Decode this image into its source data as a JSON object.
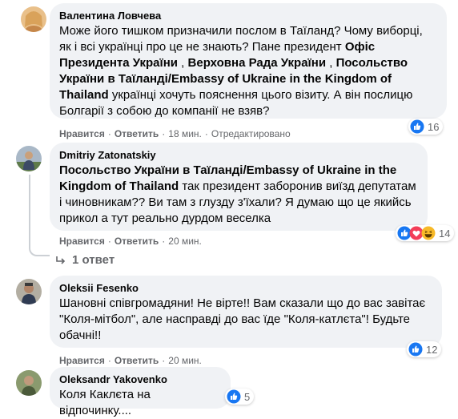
{
  "comments": [
    {
      "author": "Валентина Ловчева",
      "text_a": "Може його тишком призначили послом в Таїланд? Чому виборці, як і всі українці про це не знають? Пане президент ",
      "mention_1": "Офіс Президента України",
      "text_b": " , ",
      "mention_2": "Верховна Рада України",
      "text_c": " , ",
      "mention_3": "Посольство України в Таїланді/Embassy of Ukraine in the Kingdom of Thailand",
      "text_d": " українці хочуть пояснення цього візиту. А він послицю Болгарії з собою до компанії не взяв?",
      "like": "Нравится",
      "reply": "Ответить",
      "time": "18 мин.",
      "edited": "Отредактировано",
      "reaction_count": "16"
    },
    {
      "author": "Dmitriy Zatonatskiy",
      "mention_1": "Посольство України в Таїланді/Embassy of Ukraine in the Kingdom of Thailand",
      "text_a": " так президент заборонив виїзд депутатам і чиновникам?? Ви там з глузду з'їхали? Я думаю що це якийсь прикол а тут реально дурдом веселка",
      "like": "Нравится",
      "reply": "Ответить",
      "time": "20 мин.",
      "reaction_count": "14",
      "replies_label": "1 ответ"
    },
    {
      "author": "Oleksii Fesenko",
      "text_a": "Шановні співгромадяни! Не вірте!! Вам сказали що до вас завітає \"Коля-мітбол\", але насправді до вас їде \"Коля-катлєта\"! Будьте обачні!!",
      "like": "Нравится",
      "reply": "Ответить",
      "time": "20 мин.",
      "reaction_count": "12"
    },
    {
      "author": "Oleksandr Yakovenko",
      "text_a": "Коля Каклєта на відпочинку....",
      "reaction_count": "5"
    }
  ],
  "colors": {
    "bubble": "#f0f2f5",
    "meta": "#65676b",
    "like_blue": "#1877f2",
    "love_red": "#f33e58",
    "haha_yellow": "#f7b928"
  },
  "icons": [
    "like-reaction-icon",
    "love-reaction-icon",
    "haha-reaction-icon",
    "reply-arrow-icon"
  ]
}
